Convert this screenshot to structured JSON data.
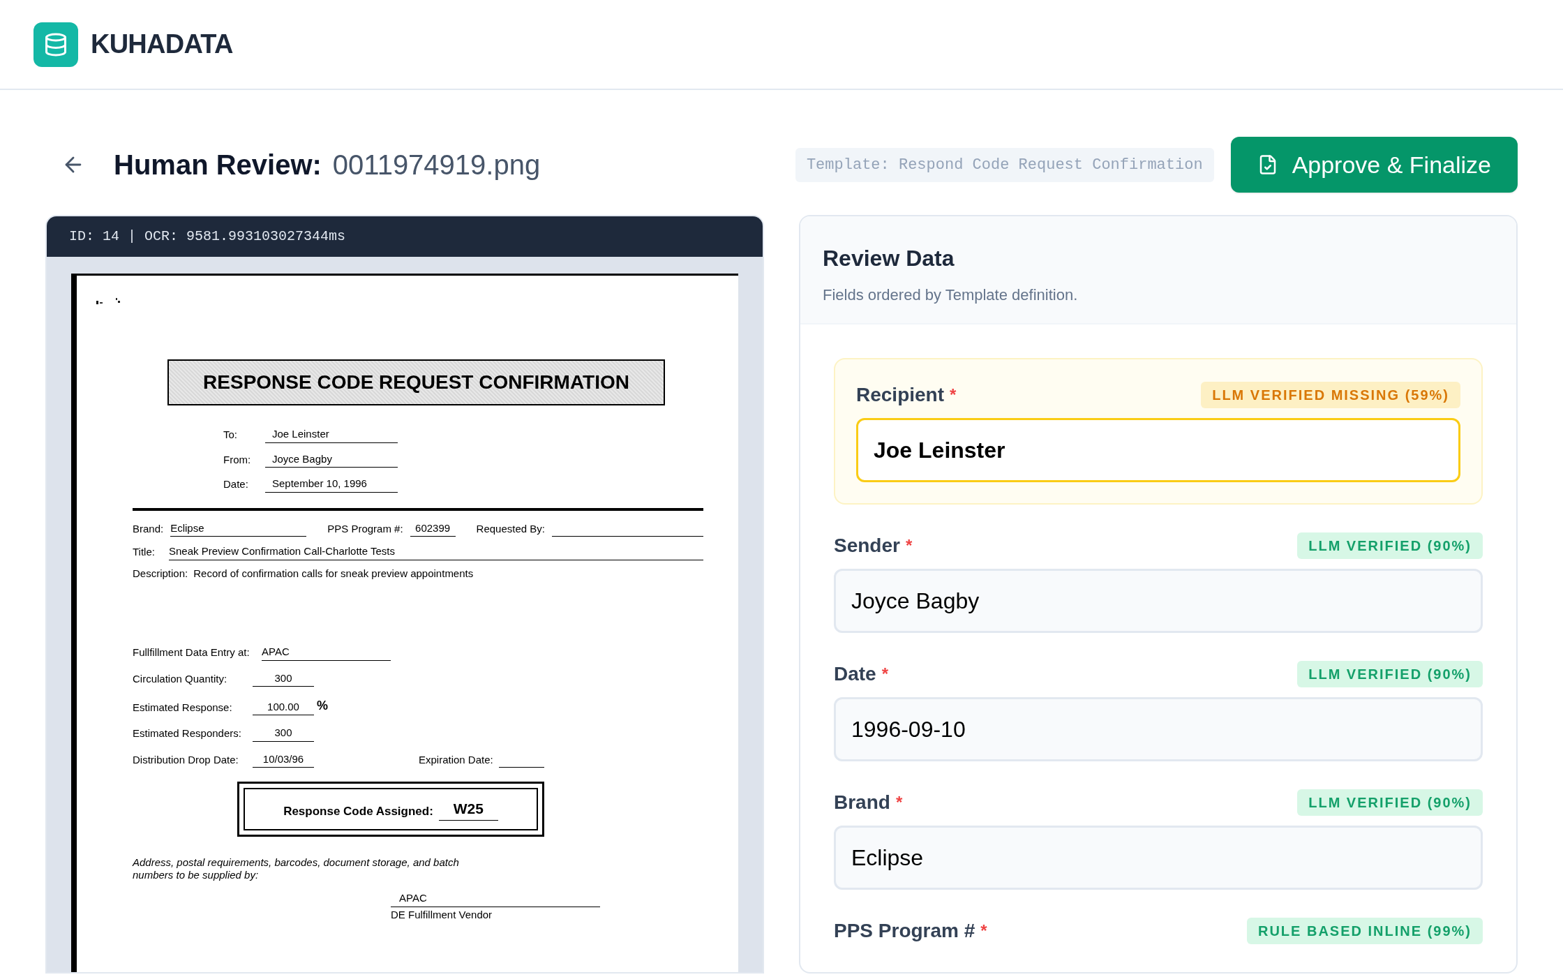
{
  "brand": {
    "name": "KUHADATA"
  },
  "page": {
    "title": "Human Review:",
    "filename": "0011974919.png",
    "template": "Template: Respond Code Request Confirmation",
    "approve_button": "Approve & Finalize"
  },
  "viewer": {
    "header": "ID: 14 | OCR: 9581.993103027344ms",
    "document": {
      "heading": "RESPONSE CODE REQUEST CONFIRMATION",
      "memo": [
        {
          "label": "To:",
          "value": "Joe Leinster"
        },
        {
          "label": "From:",
          "value": "Joyce Bagby"
        },
        {
          "label": "Date:",
          "value": "September 10, 1996"
        }
      ],
      "brand_label": "Brand:",
      "brand": "Eclipse",
      "pps_label": "PPS Program #:",
      "pps": "602399",
      "requested_label": "Requested By:",
      "title_label": "Title:",
      "title": "Sneak Preview Confirmation Call-Charlotte Tests",
      "description_label": "Description:",
      "description": "Record of confirmation calls for sneak preview appointments",
      "stats": [
        {
          "label": "Fullfillment Data Entry at:",
          "value": "APAC",
          "kind": "wide"
        },
        {
          "label": "Circulation Quantity:",
          "value": "300",
          "kind": "short"
        },
        {
          "label": "Estimated Response:",
          "value": "100.00",
          "unit": "%",
          "kind": "short"
        },
        {
          "label": "Estimated Responders:",
          "value": "300",
          "kind": "short"
        },
        {
          "label": "Distribution Drop Date:",
          "value": "10/03/96",
          "kind": "short"
        }
      ],
      "expiration_label": "Expiration Date:",
      "response_code_label": "Response Code Assigned:",
      "response_code": "W25",
      "note": "Address, postal requirements, barcodes, document storage, and batch numbers to be supplied by:",
      "vendor": "APAC",
      "vendor_label": "DE Fulfillment Vendor"
    }
  },
  "review": {
    "title": "Review Data",
    "subtitle": "Fields ordered by Template definition.",
    "required_mark": "*",
    "fields": [
      {
        "label": "Recipient",
        "required": true,
        "badge": "LLM VERIFIED MISSING (59%)",
        "kind": "warning",
        "value": "Joe Leinster",
        "selected": true
      },
      {
        "label": "Sender",
        "required": true,
        "badge": "LLM VERIFIED (90%)",
        "kind": "success",
        "value": "Joyce Bagby",
        "selected": false
      },
      {
        "label": "Date",
        "required": true,
        "badge": "LLM VERIFIED (90%)",
        "kind": "success",
        "value": "1996-09-10",
        "selected": false
      },
      {
        "label": "Brand",
        "required": true,
        "badge": "LLM VERIFIED (90%)",
        "kind": "success",
        "value": "Eclipse",
        "selected": false
      },
      {
        "label": "PPS Program #",
        "required": true,
        "badge": "RULE BASED INLINE (99%)",
        "kind": "success",
        "selected": false
      }
    ]
  }
}
